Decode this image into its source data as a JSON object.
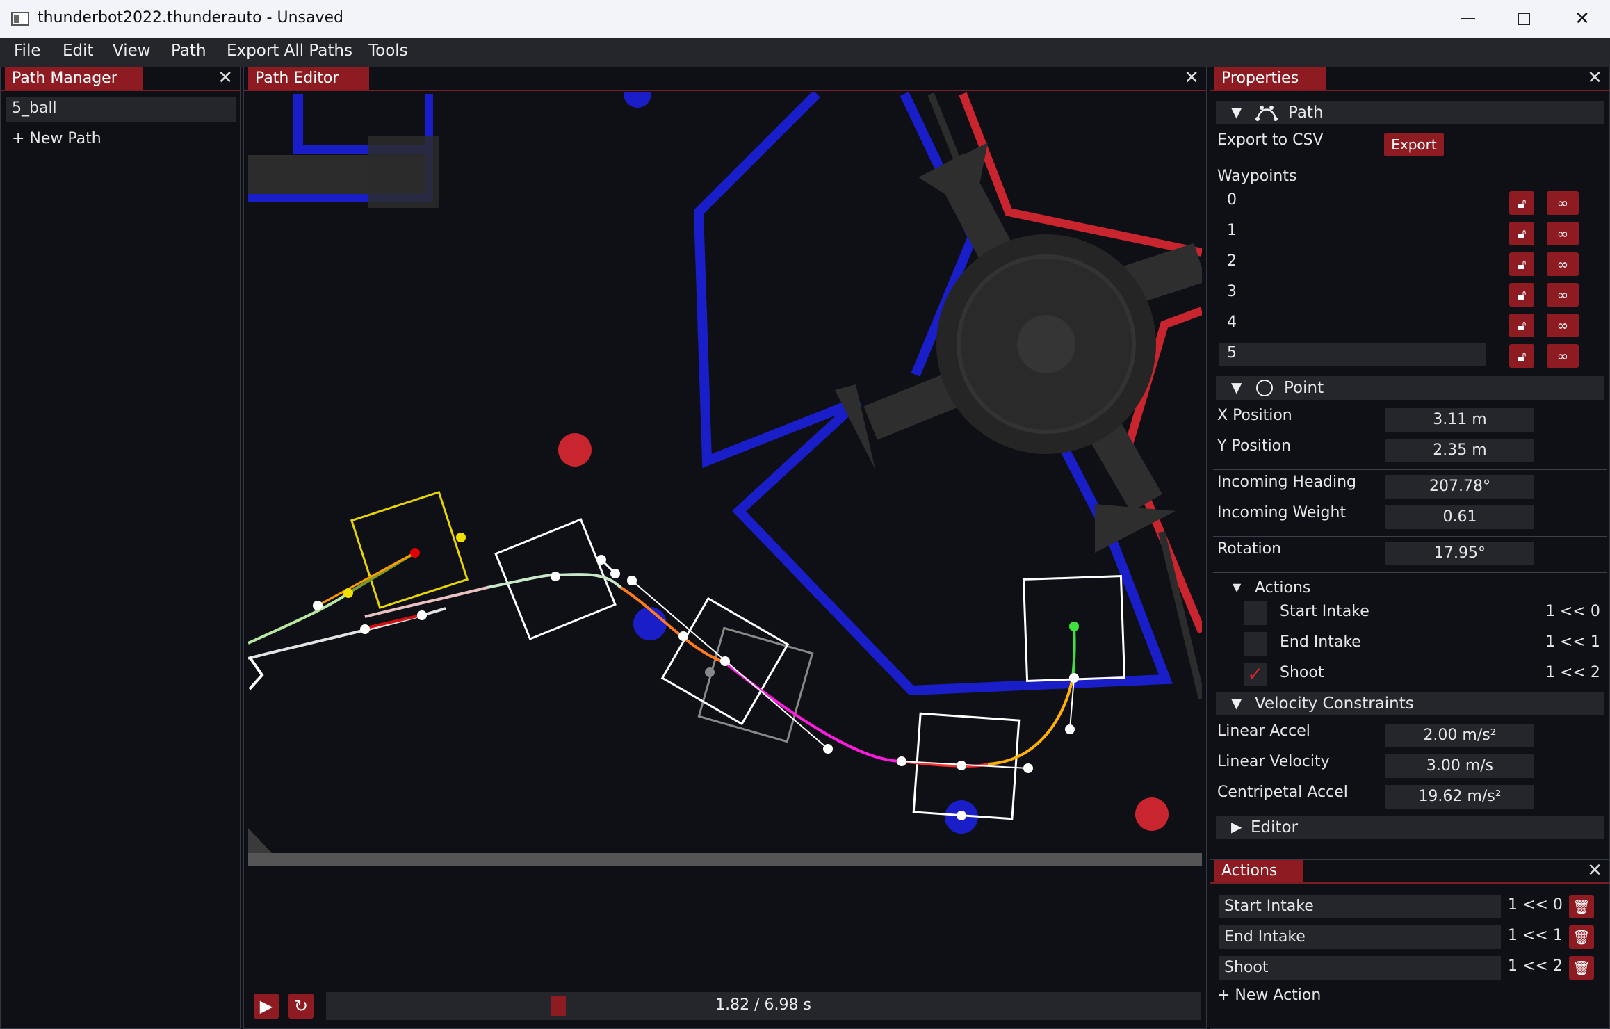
{
  "window": {
    "title": "thunderbot2022.thunderauto - Unsaved",
    "minimize_icon": "minimize-icon",
    "maximize_icon": "maximize-icon",
    "close_label": "✕"
  },
  "menu": [
    "File",
    "Edit",
    "View",
    "Path",
    "Export All Paths",
    "Tools"
  ],
  "path_manager": {
    "tab": "Path Manager",
    "close": "✕",
    "paths": [
      "5_ball"
    ],
    "new_path": "+ New Path"
  },
  "path_editor": {
    "tab": "Path Editor",
    "close": "✕",
    "playback": {
      "time": "1.82 / 6.98 s",
      "progress": 0.261,
      "play_icon": "play-icon",
      "loop_icon": "loop-icon"
    }
  },
  "properties": {
    "tab": "Properties",
    "close": "✕",
    "path_section": "Path",
    "export_label": "Export to CSV",
    "export_button": "Export",
    "waypoints_label": "Waypoints",
    "waypoints": [
      "0",
      "1",
      "2",
      "3",
      "4",
      "5"
    ],
    "selected_waypoint": 5,
    "point_section": "Point",
    "x_position": {
      "label": "X Position",
      "value": "3.11 m"
    },
    "y_position": {
      "label": "Y Position",
      "value": "2.35 m"
    },
    "incoming_heading": {
      "label": "Incoming Heading",
      "value": "207.78°"
    },
    "incoming_weight": {
      "label": "Incoming Weight",
      "value": "0.61"
    },
    "rotation": {
      "label": "Rotation",
      "value": "17.95°"
    },
    "actions_section": "Actions",
    "actions": [
      {
        "name": "Start Intake",
        "id": "1 << 0",
        "checked": false
      },
      {
        "name": "End Intake",
        "id": "1 << 1",
        "checked": false
      },
      {
        "name": "Shoot",
        "id": "1 << 2",
        "checked": true
      }
    ],
    "velocity_section": "Velocity Constraints",
    "linear_accel": {
      "label": "Linear Accel",
      "value": "2.00 m/s²"
    },
    "linear_velocity": {
      "label": "Linear Velocity",
      "value": "3.00 m/s"
    },
    "centripetal_accel": {
      "label": "Centripetal Accel",
      "value": "19.62 m/s²"
    },
    "editor_section": "Editor"
  },
  "actions_panel": {
    "tab": "Actions",
    "close": "✕",
    "actions": [
      {
        "name": "Start Intake",
        "id": "1 << 0"
      },
      {
        "name": "End Intake",
        "id": "1 << 1"
      },
      {
        "name": "Shoot",
        "id": "1 << 2"
      }
    ],
    "new_action": "+ New Action"
  },
  "colors": {
    "accent": "#8e1b22",
    "background": "#0e1016",
    "widget": "#24262c",
    "field_blue": "#1a1ec8",
    "field_red": "#c8252e",
    "hub_gray": "#2e2e2e"
  }
}
